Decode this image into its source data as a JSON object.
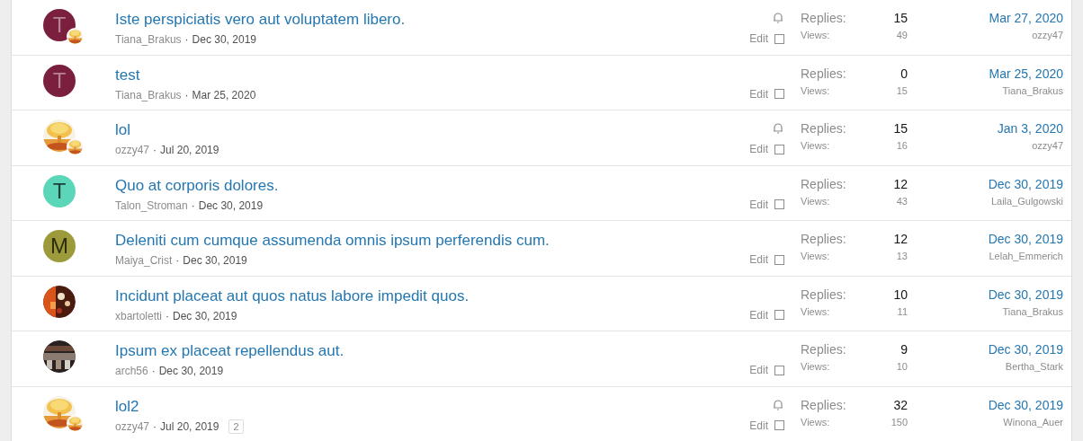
{
  "threads": [
    {
      "title": "Iste perspiciatis vero aut voluptatem libero.",
      "author": "Tiana_Brakus",
      "separator": "·",
      "date": "Dec 30, 2019",
      "avatar": {
        "kind": "letter",
        "letter": "T",
        "color": "#7a1f3d"
      },
      "overlay_avatar": true,
      "watching": true,
      "edit": "Edit",
      "selected": false,
      "replies_label": "Replies:",
      "replies": "15",
      "views_label": "Views:",
      "views": "49",
      "last_date": "Mar 27, 2020",
      "last_user": "ozzy47"
    },
    {
      "title": "test",
      "author": "Tiana_Brakus",
      "separator": "·",
      "date": "Mar 25, 2020",
      "avatar": {
        "kind": "letter",
        "letter": "T",
        "color": "#7a1f3d"
      },
      "overlay_avatar": false,
      "watching": false,
      "edit": "Edit",
      "selected": false,
      "replies_label": "Replies:",
      "replies": "0",
      "views_label": "Views:",
      "views": "15",
      "last_date": "Mar 25, 2020",
      "last_user": "Tiana_Brakus"
    },
    {
      "title": "lol",
      "author": "ozzy47",
      "separator": "·",
      "date": "Jul 20, 2019",
      "overlay_avatar": true,
      "watching": true,
      "edit": "Edit",
      "selected": false,
      "replies_label": "Replies:",
      "replies": "15",
      "views_label": "Views:",
      "views": "16",
      "last_date": "Jan 3, 2020",
      "last_user": "ozzy47"
    },
    {
      "title": "Quo at corporis dolores.",
      "author": "Talon_Stroman",
      "separator": "·",
      "date": "Dec 30, 2019",
      "avatar": {
        "kind": "letter",
        "letter": "T",
        "color": "#5cd6b8"
      },
      "overlay_avatar": false,
      "watching": false,
      "edit": "Edit",
      "selected": false,
      "replies_label": "Replies:",
      "replies": "12",
      "views_label": "Views:",
      "views": "43",
      "last_date": "Dec 30, 2019",
      "last_user": "Laila_Gulgowski"
    },
    {
      "title": "Deleniti cum cumque assumenda omnis ipsum perferendis cum.",
      "author": "Maiya_Crist",
      "separator": "·",
      "date": "Dec 30, 2019",
      "avatar": {
        "kind": "letter",
        "letter": "M",
        "color": "#9c9a3a"
      },
      "overlay_avatar": false,
      "watching": false,
      "edit": "Edit",
      "selected": false,
      "replies_label": "Replies:",
      "replies": "12",
      "views_label": "Views:",
      "views": "13",
      "last_date": "Dec 30, 2019",
      "last_user": "Lelah_Emmerich"
    },
    {
      "title": "Incidunt placeat aut quos natus labore impedit quos.",
      "author": "xbartoletti",
      "separator": "·",
      "date": "Dec 30, 2019",
      "overlay_avatar": false,
      "watching": false,
      "edit": "Edit",
      "selected": false,
      "replies_label": "Replies:",
      "replies": "10",
      "views_label": "Views:",
      "views": "11",
      "last_date": "Dec 30, 2019",
      "last_user": "Tiana_Brakus"
    },
    {
      "title": "Ipsum ex placeat repellendus aut.",
      "author": "arch56",
      "separator": "·",
      "date": "Dec 30, 2019",
      "overlay_avatar": false,
      "watching": false,
      "edit": "Edit",
      "selected": false,
      "replies_label": "Replies:",
      "replies": "9",
      "views_label": "Views:",
      "views": "10",
      "last_date": "Dec 30, 2019",
      "last_user": "Bertha_Stark"
    },
    {
      "title": "lol2",
      "author": "ozzy47",
      "separator": "·",
      "date": "Jul 20, 2019",
      "pages": [
        "2"
      ],
      "overlay_avatar": true,
      "watching": true,
      "edit": "Edit",
      "selected": false,
      "replies_label": "Replies:",
      "replies": "32",
      "views_label": "Views:",
      "views": "150",
      "last_date": "Dec 30, 2019",
      "last_user": "Winona_Auer"
    }
  ]
}
